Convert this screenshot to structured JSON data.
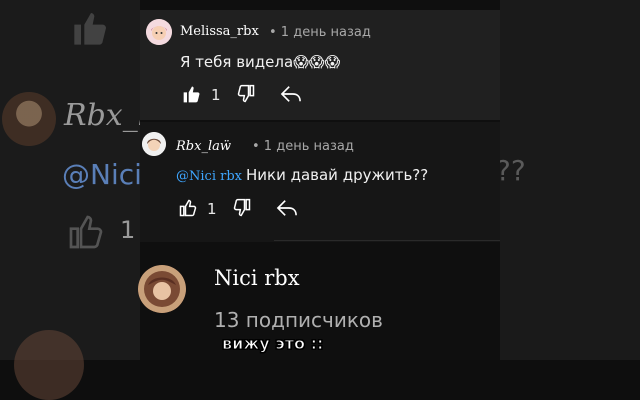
{
  "comment1": {
    "username": "Melissa_rbx",
    "time": "• 1 день назад",
    "text": "Я тебя видела😱😱😱",
    "likes": "1"
  },
  "comment2": {
    "username": "Rbx_laẅ",
    "time": "• 1 день назад",
    "mention": "@Nici rbx",
    "text": "Ники давай дружить??",
    "likes": "1"
  },
  "channel": {
    "name": "Nici rbx",
    "subscribers": "13 подписчиков"
  },
  "caption": "вижу это ::",
  "background": {
    "blurred_name": "Rbx_la",
    "blurred_mention": "@Nici",
    "blurred_qq": "??",
    "blurred_count": "1"
  },
  "colors": {
    "mention": "#3ea6ff",
    "panel": "#202020"
  }
}
